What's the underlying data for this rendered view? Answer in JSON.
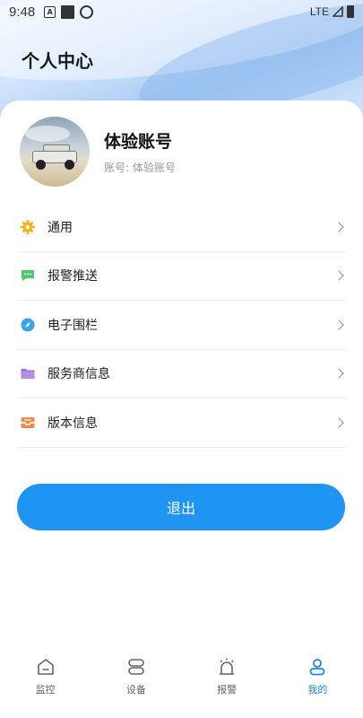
{
  "status_bar": {
    "time": "9:48",
    "network": "LTE"
  },
  "header": {
    "title": "个人中心"
  },
  "profile": {
    "name": "体验账号",
    "account": "账号: 体验账号"
  },
  "menu": [
    {
      "label": "通用",
      "icon": "gear-icon",
      "color": "#f5b31a"
    },
    {
      "label": "报警推送",
      "icon": "message-icon",
      "color": "#4cc76a"
    },
    {
      "label": "电子围栏",
      "icon": "compass-icon",
      "color": "#3aa3ee"
    },
    {
      "label": "服务商信息",
      "icon": "folder-icon",
      "color": "#9b6bd8"
    },
    {
      "label": "版本信息",
      "icon": "inbox-icon",
      "color": "#f08a4b"
    }
  ],
  "logout_label": "退出",
  "tabs": [
    {
      "label": "监控",
      "icon": "home-icon",
      "active": false
    },
    {
      "label": "设备",
      "icon": "device-icon",
      "active": false
    },
    {
      "label": "报警",
      "icon": "alarm-icon",
      "active": false
    },
    {
      "label": "我的",
      "icon": "user-icon",
      "active": true
    }
  ],
  "colors": {
    "accent": "#1e95f2",
    "active_tab": "#1e88e5"
  }
}
